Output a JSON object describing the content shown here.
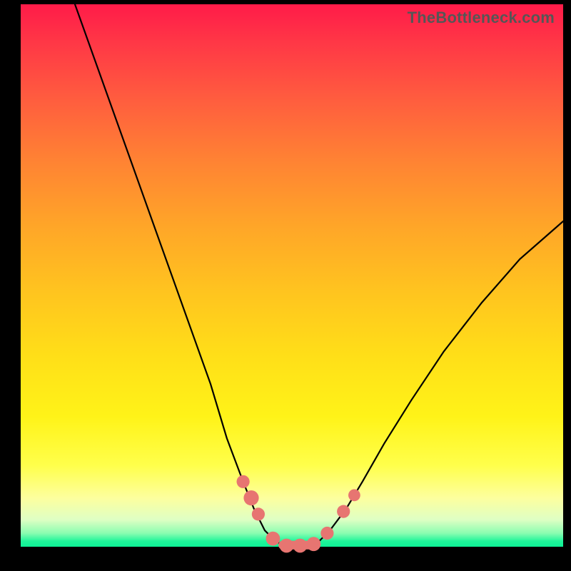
{
  "watermark": "TheBottleneck.com",
  "chart_data": {
    "type": "line",
    "title": "",
    "xlabel": "",
    "ylabel": "",
    "xlim": [
      0,
      100
    ],
    "ylim": [
      0,
      100
    ],
    "series": [
      {
        "name": "bottleneck-curve",
        "x": [
          10,
          15,
          20,
          25,
          30,
          35,
          38,
          41,
          43,
          45,
          47,
          49,
          51,
          53,
          55,
          57,
          60,
          63,
          67,
          72,
          78,
          85,
          92,
          100
        ],
        "values": [
          100,
          86,
          72,
          58,
          44,
          30,
          20,
          12,
          7,
          3,
          1,
          0,
          0,
          0,
          1,
          3,
          7,
          12,
          19,
          27,
          36,
          45,
          53,
          60
        ]
      }
    ],
    "markers": [
      {
        "name": "marker-a",
        "x": 41.0,
        "y": 12.0,
        "r": 1.2
      },
      {
        "name": "marker-b",
        "x": 42.5,
        "y": 9.0,
        "r": 1.4
      },
      {
        "name": "marker-c",
        "x": 43.8,
        "y": 6.0,
        "r": 1.2
      },
      {
        "name": "marker-d",
        "x": 46.5,
        "y": 1.5,
        "r": 1.3
      },
      {
        "name": "marker-e",
        "x": 49.0,
        "y": 0.2,
        "r": 1.3
      },
      {
        "name": "marker-f",
        "x": 51.5,
        "y": 0.2,
        "r": 1.3
      },
      {
        "name": "marker-g",
        "x": 54.0,
        "y": 0.5,
        "r": 1.3
      },
      {
        "name": "marker-h",
        "x": 56.5,
        "y": 2.5,
        "r": 1.2
      },
      {
        "name": "marker-i",
        "x": 59.5,
        "y": 6.5,
        "r": 1.2
      },
      {
        "name": "marker-j",
        "x": 61.5,
        "y": 9.5,
        "r": 1.1
      }
    ],
    "plateau": {
      "x0": 47.5,
      "x1": 55.0,
      "y": 0.3,
      "thickness": 1.6
    },
    "colors": {
      "curve": "#000000",
      "markers": "#e77571",
      "plateau": "#e77571"
    }
  }
}
